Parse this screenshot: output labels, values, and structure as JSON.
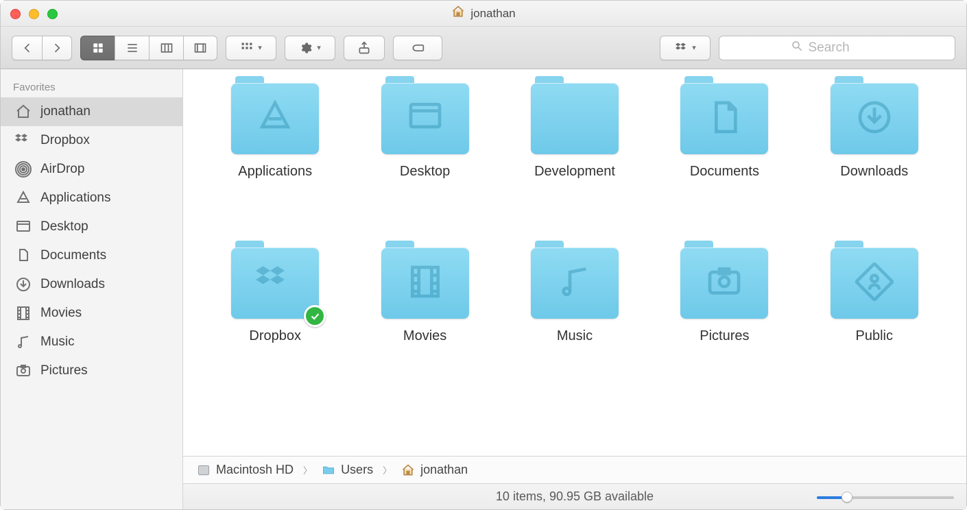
{
  "window": {
    "title": "jonathan"
  },
  "toolbar": {
    "search_placeholder": "Search"
  },
  "sidebar": {
    "header": "Favorites",
    "items": [
      {
        "label": "jonathan",
        "icon": "home",
        "selected": true
      },
      {
        "label": "Dropbox",
        "icon": "dropbox",
        "selected": false
      },
      {
        "label": "AirDrop",
        "icon": "airdrop",
        "selected": false
      },
      {
        "label": "Applications",
        "icon": "app",
        "selected": false
      },
      {
        "label": "Desktop",
        "icon": "desktop",
        "selected": false
      },
      {
        "label": "Documents",
        "icon": "documents",
        "selected": false
      },
      {
        "label": "Downloads",
        "icon": "download",
        "selected": false
      },
      {
        "label": "Movies",
        "icon": "movies",
        "selected": false
      },
      {
        "label": "Music",
        "icon": "music",
        "selected": false
      },
      {
        "label": "Pictures",
        "icon": "pictures",
        "selected": false
      }
    ]
  },
  "files": [
    {
      "label": "Applications",
      "glyph": "app",
      "synced": false
    },
    {
      "label": "Desktop",
      "glyph": "desktop",
      "synced": false
    },
    {
      "label": "Development",
      "glyph": "",
      "synced": false
    },
    {
      "label": "Documents",
      "glyph": "doc",
      "synced": false
    },
    {
      "label": "Downloads",
      "glyph": "download",
      "synced": false
    },
    {
      "label": "Dropbox",
      "glyph": "dropbox",
      "synced": true
    },
    {
      "label": "Movies",
      "glyph": "movies",
      "synced": false
    },
    {
      "label": "Music",
      "glyph": "music",
      "synced": false
    },
    {
      "label": "Pictures",
      "glyph": "pictures",
      "synced": false
    },
    {
      "label": "Public",
      "glyph": "public",
      "synced": false
    }
  ],
  "path": [
    {
      "label": "Macintosh HD",
      "icon": "disk"
    },
    {
      "label": "Users",
      "icon": "folder"
    },
    {
      "label": "jonathan",
      "icon": "home"
    }
  ],
  "status": {
    "text": "10 items, 90.95 GB available",
    "slider_percent": 22
  }
}
